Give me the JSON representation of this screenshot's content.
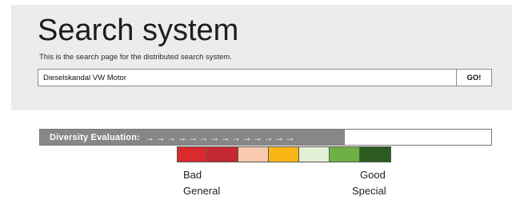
{
  "search": {
    "title": "Search system",
    "subtitle": "This is the search page for the distributed search system.",
    "query": "Dieselskandal VW Motor",
    "go_label": "GO!"
  },
  "diversity": {
    "label": "Diversity Evaluation:",
    "arrows": "→→→→→→→→→→→→→→",
    "fill_fraction": 0.675
  },
  "scale": {
    "colors": [
      "#d92a2e",
      "#c42833",
      "#f7c9ad",
      "#f7b516",
      "#e2f0d6",
      "#6fb044",
      "#2d5a1f"
    ],
    "left_top_label": "Bad",
    "left_bottom_label": "General",
    "right_top_label": "Good",
    "right_bottom_label": "Special"
  }
}
